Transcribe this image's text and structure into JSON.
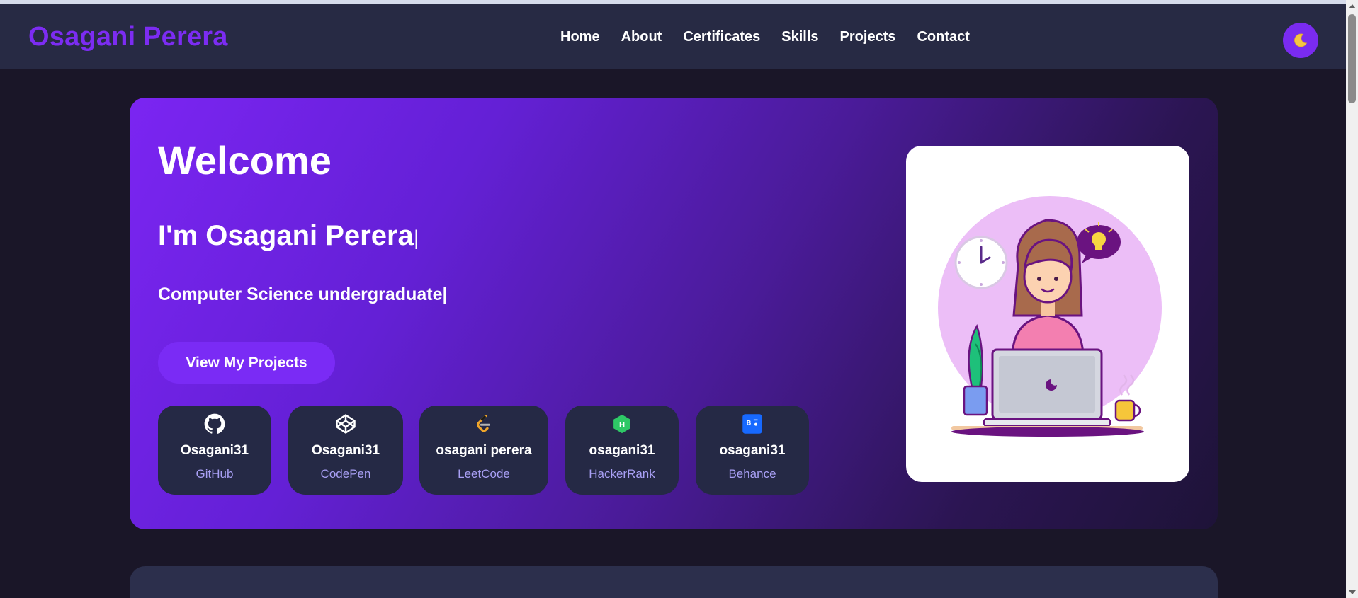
{
  "brand": "Osagani Perera",
  "nav": {
    "items": [
      {
        "label": "Home"
      },
      {
        "label": "About"
      },
      {
        "label": "Certificates"
      },
      {
        "label": "Skills"
      },
      {
        "label": "Projects"
      },
      {
        "label": "Contact"
      }
    ]
  },
  "theme_toggle": {
    "icon": "moon-icon",
    "glyph": "🌙"
  },
  "hero": {
    "welcome": "Welcome",
    "intro": "I'm Osagani Perera",
    "subtitle": "Computer Science undergraduate",
    "cursor": "|",
    "cta_label": "View My Projects",
    "profiles": [
      {
        "username": "Osagani31",
        "site": "GitHub",
        "icon": "github-icon"
      },
      {
        "username": "Osagani31",
        "site": "CodePen",
        "icon": "codepen-icon"
      },
      {
        "username": "osagani perera",
        "site": "LeetCode",
        "icon": "leetcode-icon"
      },
      {
        "username": "osagani31",
        "site": "HackerRank",
        "icon": "hackerrank-icon"
      },
      {
        "username": "osagani31",
        "site": "Behance",
        "icon": "behance-icon"
      }
    ]
  },
  "colors": {
    "brand": "#7c2cf2",
    "navbar": "#272a44",
    "page_bg": "#1a1628",
    "accent_button": "#7a2bf5",
    "card_bg": "#252945",
    "site_label": "#a9a0f5"
  }
}
